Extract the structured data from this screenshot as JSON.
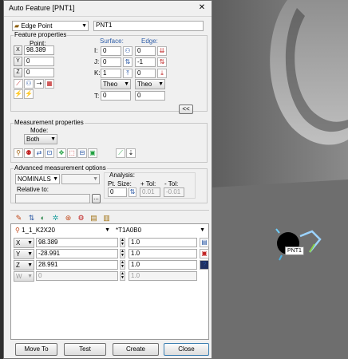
{
  "dialog": {
    "title": "Auto Feature [PNT1]",
    "close_glyph": "✕",
    "feature_type": "Edge Point",
    "feature_name": "PNT1"
  },
  "feature_properties": {
    "legend": "Feature properties",
    "point_header": "Point:",
    "surface_header": "Surface:",
    "edge_header": "Edge:",
    "x_label": "X",
    "y_label": "Y",
    "z_label": "Z",
    "x_value": "98.389",
    "y_value": "0",
    "z_value": "0",
    "i_label": "I:",
    "j_label": "J:",
    "k_label": "K:",
    "t_label": "T:",
    "surface_i": "0",
    "surface_j": "0",
    "surface_k": "1",
    "edge_i": "0",
    "edge_j": "-1",
    "edge_k": "0",
    "surface_mode": "Theo",
    "edge_mode": "Theo",
    "t_surface": "0",
    "t_edge": "0",
    "collapse_label": "<<"
  },
  "measurement_properties": {
    "legend": "Measurement properties",
    "mode_label": "Mode:",
    "mode_value": "Both"
  },
  "advanced": {
    "legend": "Advanced measurement options",
    "nominals": "NOMINALS",
    "relative_to": "Relative to:",
    "browse": "...",
    "analysis_label": "Analysis:",
    "pt_size_label": "Pt. Size:",
    "plus_tol_label": "+ Tol:",
    "minus_tol_label": "- Tol:",
    "pt_size": "0",
    "plus_tol": "0.01",
    "minus_tol": "-0.01"
  },
  "probe": {
    "tip": "1_1_K2X20",
    "tip_angle": "*T1A0B0",
    "rows": [
      {
        "axis": "X",
        "value": "98.389",
        "size": "1.0",
        "dim": false
      },
      {
        "axis": "Y",
        "value": "-28.991",
        "size": "1.0",
        "dim": false
      },
      {
        "axis": "Z",
        "value": "28.991",
        "size": "1.0",
        "dim": false
      },
      {
        "axis": "W",
        "value": "0",
        "size": "1.0",
        "dim": true
      }
    ]
  },
  "buttons": {
    "move_to": "Move To",
    "test": "Test",
    "create": "Create",
    "close": "Close"
  },
  "viewport": {
    "point_label": "PNT1"
  }
}
